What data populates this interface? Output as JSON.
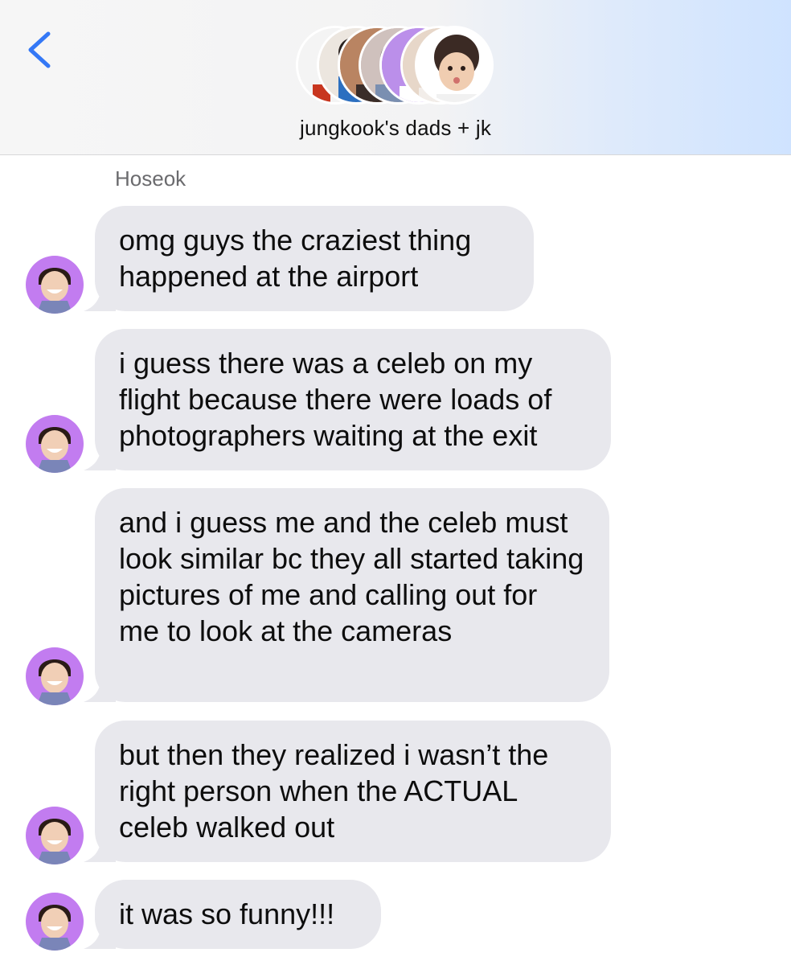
{
  "header": {
    "group_name": "jungkook's dads + jk",
    "back_icon": "chevron-left-icon",
    "accent_color": "#3478f6"
  },
  "sender": {
    "name": "Hoseok"
  },
  "messages": [
    {
      "text": "omg guys the craziest thing happened at the airport"
    },
    {
      "text": "i guess there was a celeb on my flight because there were loads of photographers waiting at the exit"
    },
    {
      "text": "and i guess me and the celeb must look similar bc they all started taking pictures of me and calling out for me to look at the cameras"
    },
    {
      "text": "but then they realized i wasn’t the right person when the ACTUAL celeb walked out"
    },
    {
      "text": "it was so funny!!!"
    }
  ],
  "colors": {
    "bubble_background": "#e8e8ed",
    "avatar_background": "#c27cf0"
  }
}
